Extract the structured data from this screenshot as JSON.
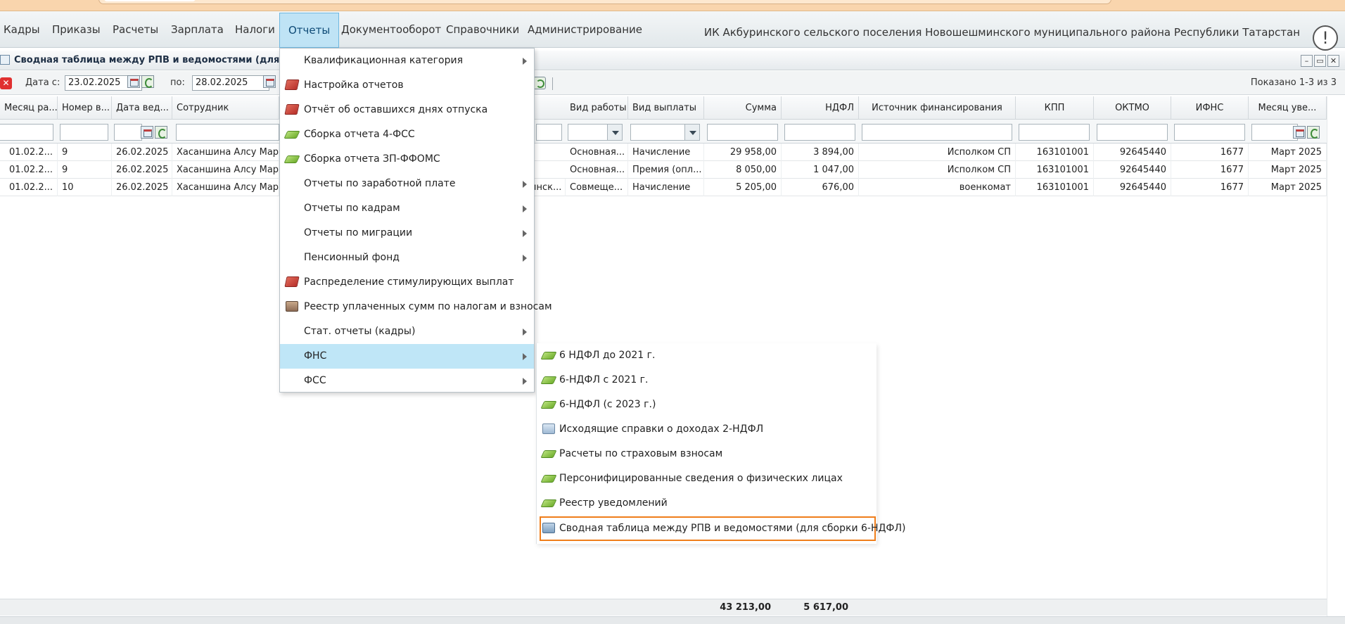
{
  "menubar": {
    "items": [
      "Кадры",
      "Приказы",
      "Расчеты",
      "Зарплата",
      "Налоги",
      "Отчеты",
      "Документооборот",
      "Справочники",
      "Администрирование"
    ],
    "active": "Отчеты",
    "org_name": "ИК Акбуринского сельского поселения Новошешминского муниципального района Республики Татарстан",
    "alert_glyph": "!"
  },
  "window": {
    "title": "Сводная таблица между РПВ и ведомостями (для сб",
    "btn_min": "–",
    "btn_max": "▭",
    "btn_close": "✕"
  },
  "toolbar": {
    "close_glyph": "✕",
    "date_from_label": "Дата с:",
    "date_from": "23.02.2025",
    "date_to_label": "по:",
    "date_to": "28.02.2025",
    "shown": "Показано 1-3 из 3"
  },
  "grid": {
    "columns": [
      "Месяц ра...",
      "Номер в...",
      "Дата вед...",
      "Сотрудник",
      "Вид работы",
      "Вид выплаты",
      "Сумма",
      "НДФЛ",
      "Источник финансирования",
      "КПП",
      "ОКТМО",
      "ИФНС",
      "Месяц уве..."
    ],
    "rows": [
      {
        "month": "01.02.2...",
        "num": "9",
        "date": "26.02.2025",
        "employee": "Хасаншина Алсу Марат",
        "work": "Основная...",
        "payment": "Начисление",
        "sum": "29 958,00",
        "ndfl": "3 894,00",
        "source": "Исполком СП",
        "kpp": "163101001",
        "oktmo": "92645440",
        "ifns": "1677",
        "notice_month": "Март 2025",
        "hidden": ""
      },
      {
        "month": "01.02.2...",
        "num": "9",
        "date": "26.02.2025",
        "employee": "Хасаншина Алсу Марат",
        "work": "Основная...",
        "payment": "Премия (опл...",
        "sum": "8 050,00",
        "ndfl": "1 047,00",
        "source": "Исполком СП",
        "kpp": "163101001",
        "oktmo": "92645440",
        "ifns": "1677",
        "notice_month": "Март 2025",
        "hidden": ""
      },
      {
        "month": "01.02.2...",
        "num": "10",
        "date": "26.02.2025",
        "employee": "Хасаншина Алсу Марат",
        "work": "Совмеще...",
        "payment": "Начисление",
        "sum": "5 205,00",
        "ndfl": "676,00",
        "source": "военкомат",
        "kpp": "163101001",
        "oktmo": "92645440",
        "ifns": "1677",
        "notice_month": "Март 2025",
        "hidden": "инск..."
      }
    ],
    "totals": {
      "sum": "43 213,00",
      "ndfl": "5 617,00"
    }
  },
  "reports_menu": {
    "items": [
      {
        "label": "Квалификационная категория",
        "icon": "none",
        "submenu": true
      },
      {
        "label": "Настройка отчетов",
        "icon": "red-book-icon",
        "submenu": false
      },
      {
        "label": "Отчёт об оставшихся днях отпуска",
        "icon": "red-book-icon",
        "submenu": false
      },
      {
        "label": "Сборка отчета 4-ФСС",
        "icon": "green-book-icon",
        "submenu": false
      },
      {
        "label": "Сборка отчета ЗП-ФФОМС",
        "icon": "green-book-icon",
        "submenu": false
      },
      {
        "label": "Отчеты по заработной плате",
        "icon": "none",
        "submenu": true
      },
      {
        "label": "Отчеты по кадрам",
        "icon": "none",
        "submenu": true
      },
      {
        "label": "Отчеты по миграции",
        "icon": "none",
        "submenu": true
      },
      {
        "label": "Пенсионный фонд",
        "icon": "none",
        "submenu": true
      },
      {
        "label": "Распределение стимулирующих выплат",
        "icon": "red-book-icon",
        "submenu": false
      },
      {
        "label": "Реестр уплаченных сумм по налогам и взносам",
        "icon": "registry-icon",
        "submenu": false
      },
      {
        "label": "Стат. отчеты (кадры)",
        "icon": "none",
        "submenu": true
      },
      {
        "label": "ФНС",
        "icon": "none",
        "submenu": true
      },
      {
        "label": "ФСС",
        "icon": "none",
        "submenu": true
      }
    ],
    "active": "ФНС"
  },
  "fns_submenu": {
    "items": [
      {
        "label": "6 НДФЛ до 2021 г.",
        "icon": "green-book-icon"
      },
      {
        "label": "6-НДФЛ с 2021 г.",
        "icon": "green-book-icon"
      },
      {
        "label": "6-НДФЛ (с 2023 г.)",
        "icon": "green-book-icon"
      },
      {
        "label": "Исходящие справки о доходах 2-НДФЛ",
        "icon": "document-icon"
      },
      {
        "label": "Расчеты по страховым взносам",
        "icon": "green-book-icon"
      },
      {
        "label": "Персонифицированные сведения о физических лицах",
        "icon": "green-book-icon"
      },
      {
        "label": "Реестр уведомлений",
        "icon": "green-book-icon"
      },
      {
        "label": "Сводная таблица между РПВ и ведомостями (для сборки 6-НДФЛ)",
        "icon": "table-icon"
      }
    ],
    "highlighted": "Сводная таблица между РПВ и ведомостями (для сборки 6-НДФЛ)"
  },
  "colors": {
    "accent": "#bfe6f7",
    "highlight_border": "#ef7d1a",
    "top_strip": "#f9d5ad"
  }
}
